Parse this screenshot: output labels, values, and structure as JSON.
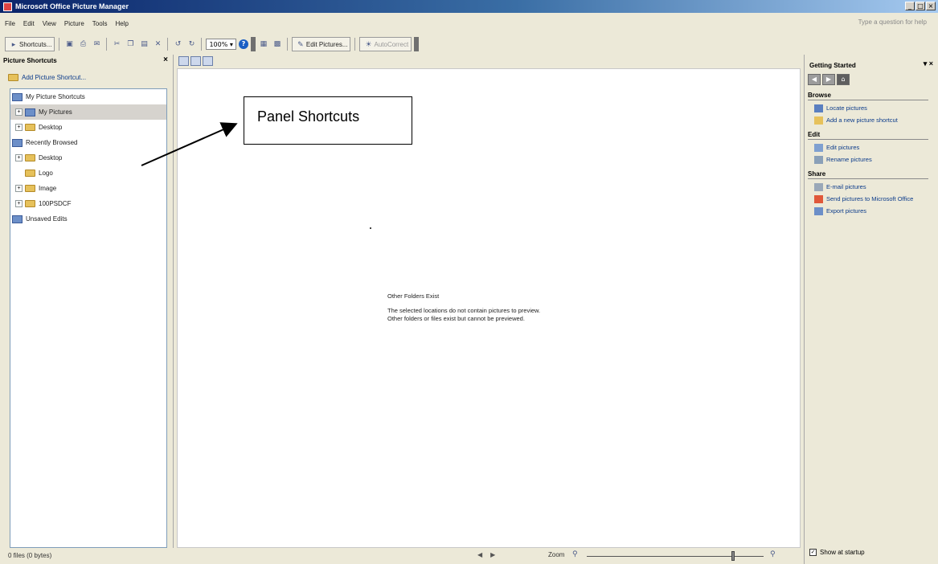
{
  "window": {
    "title": "Microsoft Office Picture Manager",
    "controls": [
      "_",
      "□",
      "×"
    ]
  },
  "menubar": {
    "items": [
      "File",
      "Edit",
      "View",
      "Picture",
      "Tools",
      "Help"
    ],
    "help_placeholder": "Type a question for help"
  },
  "toolbar": {
    "shortcuts_label": "Shortcuts...",
    "zoom_value": "100%",
    "edit_pictures_label": "Edit Pictures...",
    "auto_correct_label": "AutoCorrect"
  },
  "left_pane": {
    "title": "Picture Shortcuts",
    "add_shortcut_label": "Add Picture Shortcut...",
    "tree": [
      {
        "label": "My Picture Shortcuts",
        "expander": ""
      },
      {
        "label": "My Pictures",
        "expander": "+"
      },
      {
        "label": "Desktop",
        "expander": "+"
      },
      {
        "label": "Recently Browsed",
        "expander": ""
      },
      {
        "label": "Desktop",
        "expander": "+"
      },
      {
        "label": "Logo",
        "expander": ""
      },
      {
        "label": "Image",
        "expander": "+"
      },
      {
        "label": "100PSDCF",
        "expander": "+"
      },
      {
        "label": "Unsaved Edits",
        "expander": ""
      }
    ],
    "status": "0 files (0 bytes)"
  },
  "main": {
    "callout": "Panel Shortcuts",
    "message_title": "Other Folders Exist",
    "message_line1": "The selected locations do not contain pictures to preview.",
    "message_line2": "Other folders or files exist but cannot be previewed.",
    "zoom_label": "Zoom"
  },
  "right_pane": {
    "title": "Getting Started",
    "sections": [
      {
        "title": "Browse",
        "links": [
          "Locate pictures",
          "Add a new picture shortcut"
        ]
      },
      {
        "title": "Edit",
        "links": [
          "Edit pictures",
          "Rename pictures"
        ]
      },
      {
        "title": "Share",
        "links": [
          "E-mail pictures",
          "Send pictures to Microsoft Office",
          "Export pictures"
        ]
      }
    ],
    "show_at_startup_label": "Show at startup",
    "show_at_startup_checked": true
  }
}
